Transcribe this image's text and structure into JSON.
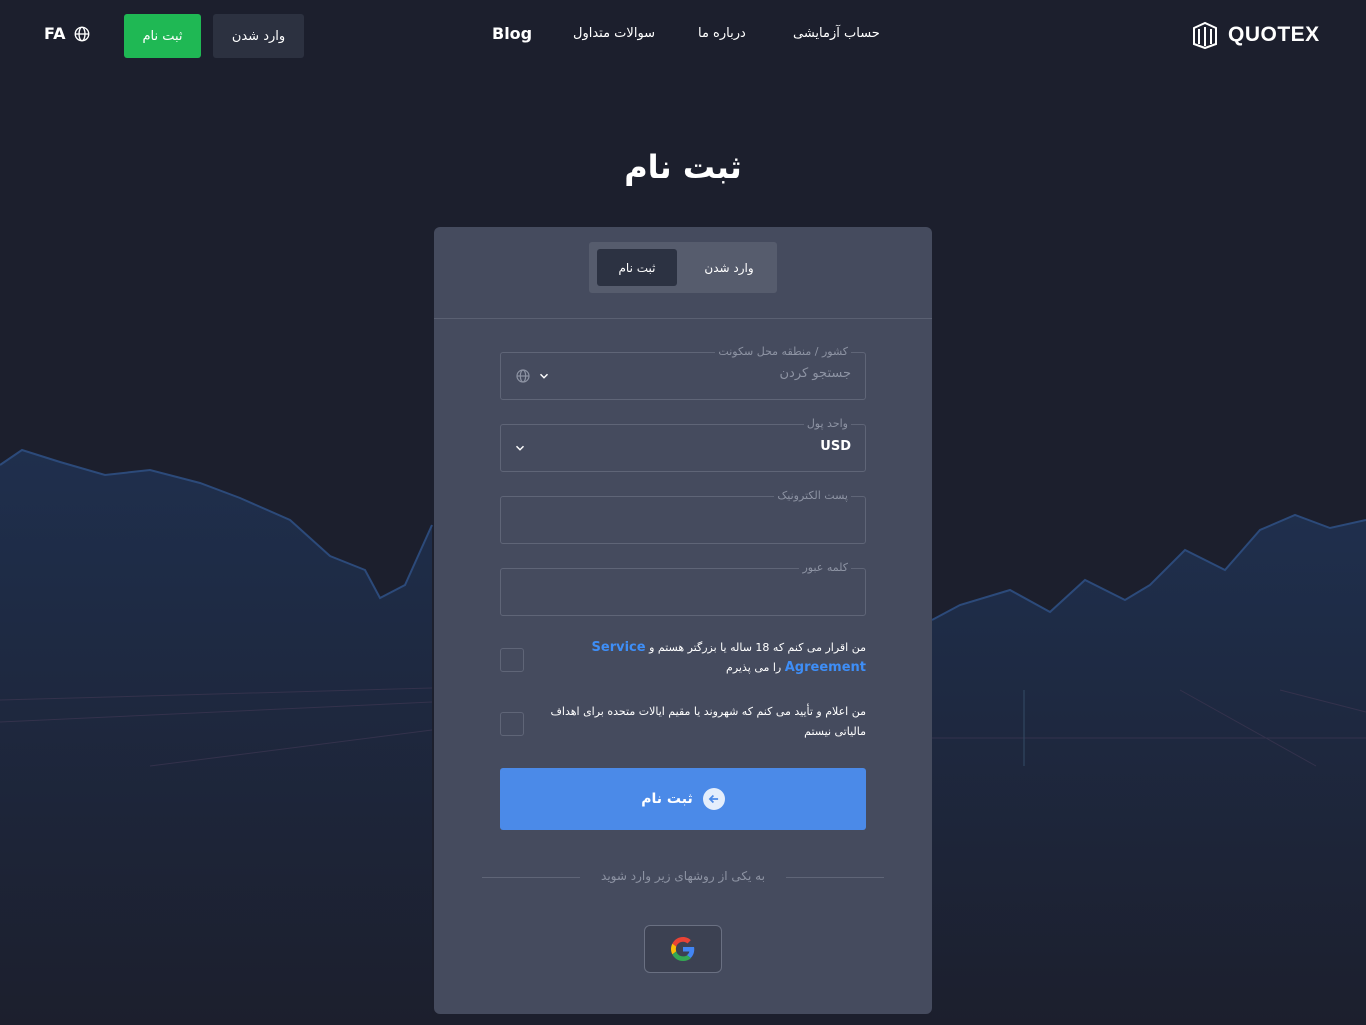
{
  "header": {
    "language": "FA",
    "register_button": "ثبت نام",
    "login_button": "وارد شدن",
    "nav": {
      "blog": "Blog",
      "faq": "سوالات متداول",
      "about": "درباره ما",
      "demo": "حساب آزمایشی"
    },
    "logo_text": "QUOTEX"
  },
  "page": {
    "title": "ثبت نام"
  },
  "form": {
    "tabs": {
      "login": "وارد شدن",
      "register": "ثبت نام"
    },
    "country": {
      "label": "کشور / منطقه محل سکونت",
      "placeholder": "جستجو کردن"
    },
    "currency": {
      "label": "واحد پول",
      "value": "USD"
    },
    "email": {
      "label": "پست الکترونیک",
      "value": ""
    },
    "password": {
      "label": "کلمه عبور",
      "value": ""
    },
    "agree_age": {
      "text_before": "من اقرار می کنم که 18 ساله یا بزرگتر هستم و",
      "link": "Service Agreement",
      "text_after": "را می پذیرم",
      "checked": false
    },
    "agree_us": {
      "text": "من اعلام و تأیید می کنم که شهروند یا مقیم ایالات متحده برای اهداف مالیاتی نیستم",
      "checked": false
    },
    "submit_label": "ثبت نام",
    "social_divider": "به یکی از روشهای زیر وارد شوید",
    "social_icon": "google-icon"
  },
  "colors": {
    "background": "#1c1f2d",
    "card": "#454b5e",
    "register_green": "#1fb854",
    "primary_blue": "#4b8ae8",
    "link_blue": "#3e8ef7"
  }
}
